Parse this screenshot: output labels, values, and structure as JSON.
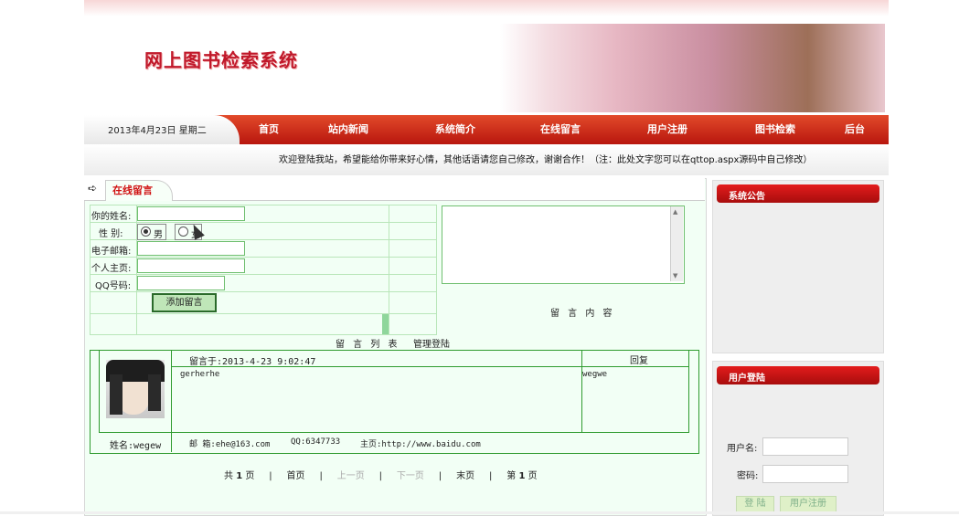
{
  "site": {
    "title": "网上图书检索系统",
    "date": "2013年4月23日 星期二",
    "notice": "欢迎登陆我站，希望能给你带来好心情，其他话语请您自己修改，谢谢合作！（注：此处文字您可以在qttop.aspx源码中自己修改）"
  },
  "nav": {
    "items": [
      "首页",
      "站内新闻",
      "系统简介",
      "在线留言",
      "用户注册",
      "图书检索",
      "后台"
    ]
  },
  "form": {
    "tab_label": "在线留言",
    "name_label": "你的姓名:",
    "gender_label": "性 别:",
    "gender_male": "男",
    "gender_female": "女",
    "email_label": "电子邮箱:",
    "homepage_label": "个人主页:",
    "qq_label": "QQ号码:",
    "submit_label": "添加留言",
    "content_label": "留 言 内 容",
    "list_label": "留 言 列 表",
    "admin_label": "管理登陆"
  },
  "message": {
    "posted": "留言于:2013-4-23 9:02:47",
    "reply_header": "回复",
    "body": "gerherhe",
    "reply": "wegwe",
    "name": "姓名:wegew",
    "email": "邮 箱:ehe@163.com",
    "qq": "QQ:6347733",
    "homepage": "主页:http://www.baidu.com"
  },
  "pager": {
    "total_pre": "共",
    "total": "1",
    "total_post": "页",
    "first": "首页",
    "prev": "上一页",
    "next": "下一页",
    "last": "末页",
    "current_pre": "第",
    "current": "1",
    "current_post": "页",
    "sep": "|"
  },
  "sidebar": {
    "announcement_title": "系统公告",
    "login_title": "用户登陆",
    "username_label": "用户名:",
    "password_label": "密码:",
    "login_button": "登 陆",
    "register_button": "用户注册"
  },
  "colors": {
    "brand_red": "#c0182a",
    "nav_red": "#d23a20",
    "grid_green": "#2e9b2e"
  }
}
